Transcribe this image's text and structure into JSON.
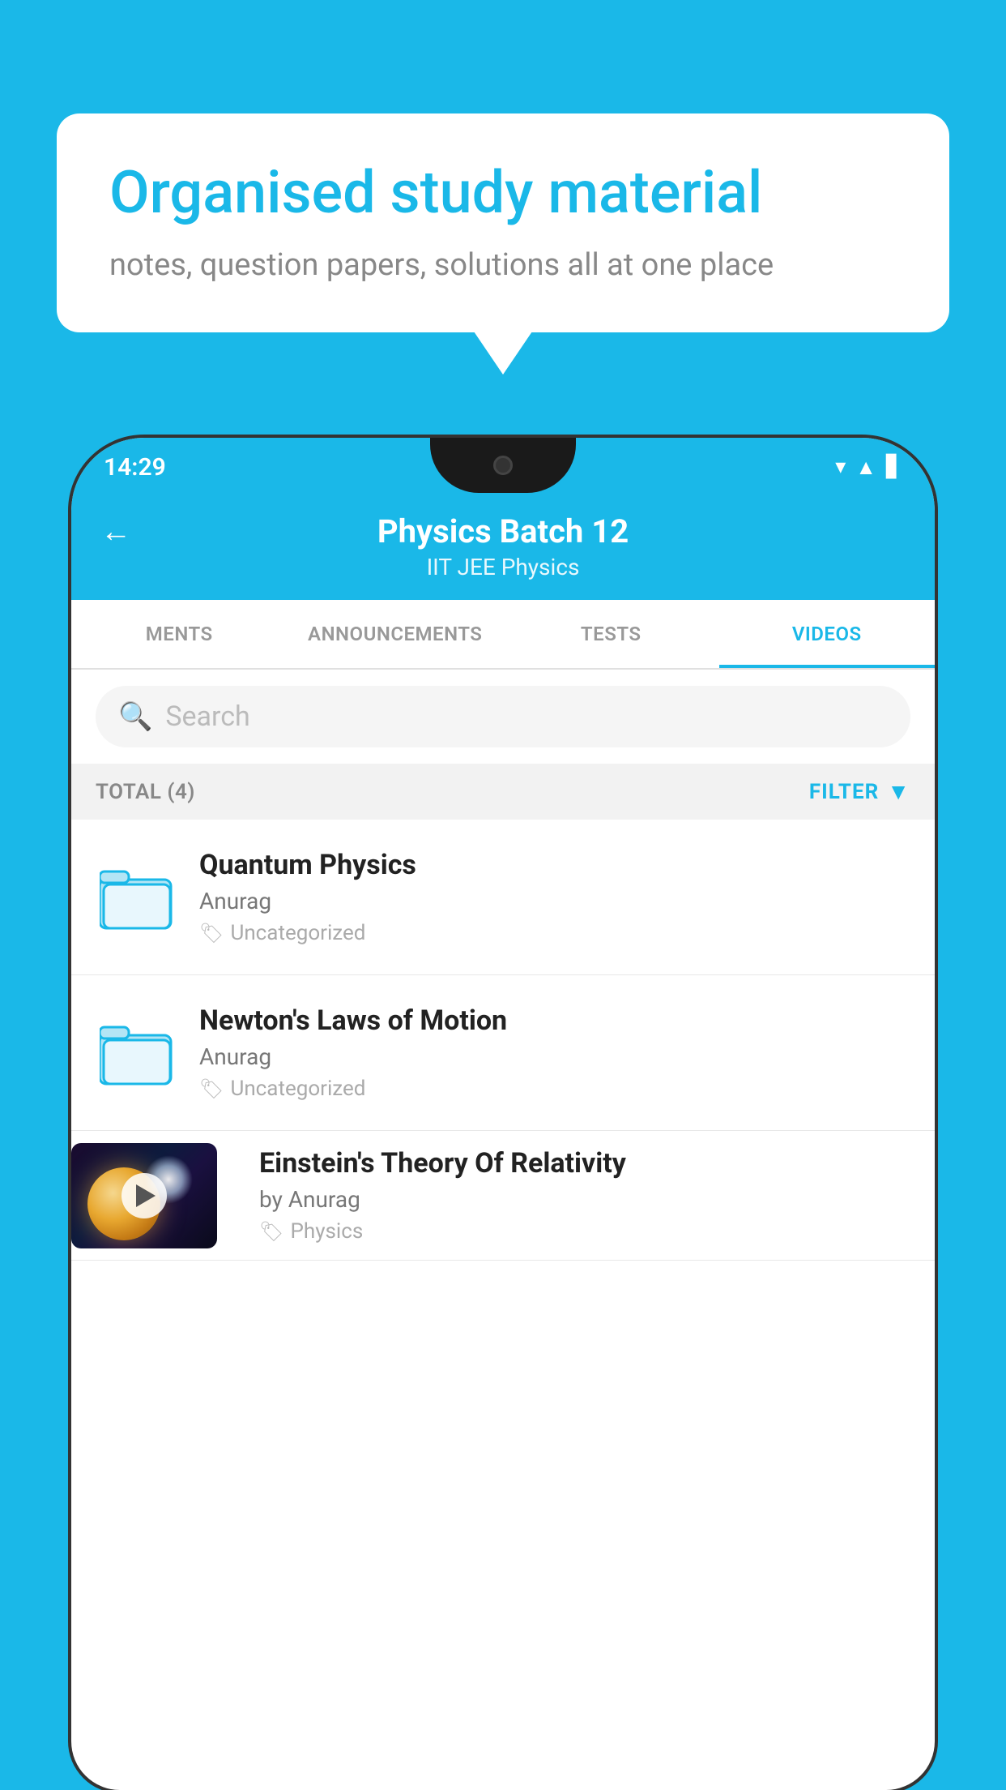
{
  "background_color": "#1ab8e8",
  "bubble": {
    "title": "Organised study material",
    "subtitle": "notes, question papers, solutions all at one place"
  },
  "phone": {
    "status_bar": {
      "time": "14:29",
      "icons": [
        "wifi",
        "signal",
        "battery"
      ]
    },
    "header": {
      "back_label": "←",
      "title": "Physics Batch 12",
      "subtitle_tags": "IIT JEE    Physics"
    },
    "tabs": [
      {
        "label": "MENTS",
        "active": false
      },
      {
        "label": "ANNOUNCEMENTS",
        "active": false
      },
      {
        "label": "TESTS",
        "active": false
      },
      {
        "label": "VIDEOS",
        "active": true
      }
    ],
    "search": {
      "placeholder": "Search"
    },
    "filter_bar": {
      "total_label": "TOTAL (4)",
      "filter_label": "FILTER"
    },
    "videos": [
      {
        "title": "Quantum Physics",
        "author": "Anurag",
        "tag": "Uncategorized",
        "type": "folder"
      },
      {
        "title": "Newton's Laws of Motion",
        "author": "Anurag",
        "tag": "Uncategorized",
        "type": "folder"
      },
      {
        "title": "Einstein's Theory Of Relativity",
        "author": "by Anurag",
        "tag": "Physics",
        "type": "thumbnail"
      }
    ]
  }
}
